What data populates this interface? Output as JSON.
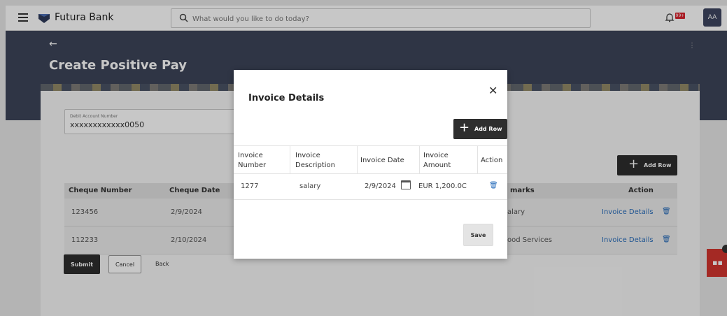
{
  "topbar": {
    "brand": "Futura Bank",
    "search_placeholder": "What would you like to do today?",
    "notification_badge": "99+",
    "avatar_initials": "AA"
  },
  "page": {
    "title": "Create Positive Pay",
    "back_icon": "arrow-left-icon"
  },
  "debit_account": {
    "label": "Debit Account Number",
    "value": "xxxxxxxxxxxx0050"
  },
  "add_row_label": "Add Row",
  "table": {
    "headers": {
      "cheque_number": "Cheque Number",
      "cheque_date": "Cheque Date",
      "remarks": "marks",
      "action": "Action"
    },
    "rows": [
      {
        "cheque_number": "123456",
        "cheque_date": "2/9/2024",
        "remarks": "alary",
        "link": "Invoice Details"
      },
      {
        "cheque_number": "112233",
        "cheque_date": "2/10/2024",
        "remarks": "ood Services",
        "link": "Invoice Details"
      }
    ]
  },
  "buttons": {
    "submit": "Submit",
    "cancel": "Cancel",
    "back": "Back"
  },
  "modal": {
    "title": "Invoice Details",
    "add_row": "Add Row",
    "headers": {
      "invoice_number": "Invoice Number",
      "invoice_description": "Invoice Description",
      "invoice_date": "Invoice Date",
      "invoice_amount": "Invoice Amount",
      "action": "Action"
    },
    "row": {
      "invoice_number": "1277",
      "invoice_description": "salary",
      "invoice_date": "2/9/2024",
      "invoice_amount": "EUR 1,200.0C"
    },
    "save": "Save"
  },
  "colors": {
    "header_band": "#3d4559",
    "primary_button": "#2e2e2e",
    "link": "#2a6ebb",
    "chat": "#d2352f"
  }
}
